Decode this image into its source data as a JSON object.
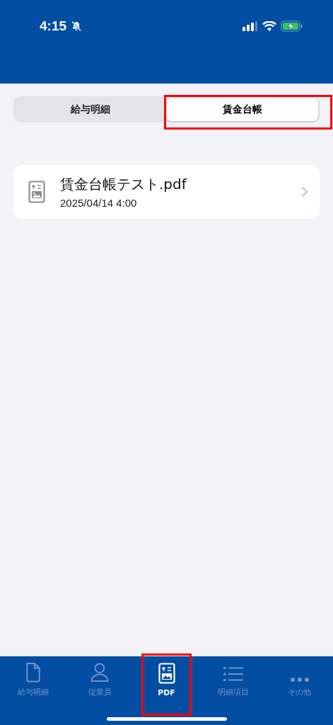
{
  "status_bar": {
    "time": "4:15"
  },
  "segments": [
    {
      "label": "給与明細",
      "selected": false,
      "highlighted": false
    },
    {
      "label": "賃金台帳",
      "selected": true,
      "highlighted": true
    }
  ],
  "files": [
    {
      "name": "賃金台帳テスト.pdf",
      "date": "2025/04/14 4:00"
    }
  ],
  "tab_bar": [
    {
      "label": "給与明細",
      "kind": "document",
      "selected": false,
      "highlighted": false
    },
    {
      "label": "従業員",
      "kind": "person",
      "selected": false,
      "highlighted": false
    },
    {
      "label": "PDF",
      "kind": "pdf",
      "selected": true,
      "highlighted": true
    },
    {
      "label": "明細項目",
      "kind": "list",
      "selected": false,
      "highlighted": false
    },
    {
      "label": "その他",
      "kind": "more",
      "selected": false,
      "highlighted": false
    }
  ]
}
